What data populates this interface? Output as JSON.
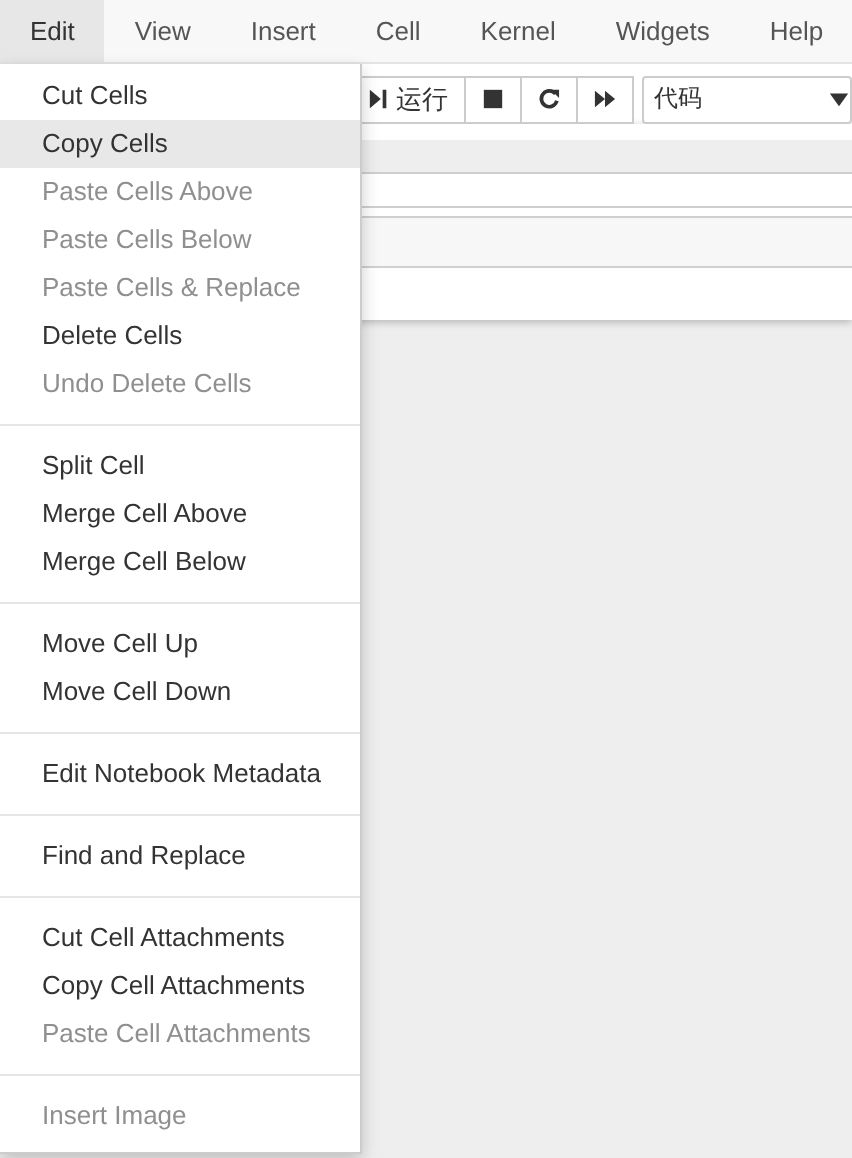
{
  "menubar": [
    {
      "label": "Edit",
      "selected": true
    },
    {
      "label": "View",
      "selected": false
    },
    {
      "label": "Insert",
      "selected": false
    },
    {
      "label": "Cell",
      "selected": false
    },
    {
      "label": "Kernel",
      "selected": false
    },
    {
      "label": "Widgets",
      "selected": false
    },
    {
      "label": "Help",
      "selected": false
    }
  ],
  "toolbar": {
    "run_button": {
      "label": "运行"
    },
    "buttons": [
      {
        "kind": "stop"
      },
      {
        "kind": "restart"
      },
      {
        "kind": "fast-forward"
      }
    ],
    "cell_type_select": {
      "value": "代码"
    }
  },
  "dropdown": {
    "groups": [
      [
        {
          "label": "Cut Cells",
          "disabled": false,
          "selected": false
        },
        {
          "label": "Copy Cells",
          "disabled": false,
          "selected": true
        },
        {
          "label": "Paste Cells Above",
          "disabled": true,
          "selected": false
        },
        {
          "label": "Paste Cells Below",
          "disabled": true,
          "selected": false
        },
        {
          "label": "Paste Cells & Replace",
          "disabled": true,
          "selected": false
        },
        {
          "label": "Delete Cells",
          "disabled": false,
          "selected": false
        },
        {
          "label": "Undo Delete Cells",
          "disabled": true,
          "selected": false
        }
      ],
      [
        {
          "label": "Split Cell",
          "disabled": false,
          "selected": false
        },
        {
          "label": "Merge Cell Above",
          "disabled": false,
          "selected": false
        },
        {
          "label": "Merge Cell Below",
          "disabled": false,
          "selected": false
        }
      ],
      [
        {
          "label": "Move Cell Up",
          "disabled": false,
          "selected": false
        },
        {
          "label": "Move Cell Down",
          "disabled": false,
          "selected": false
        }
      ],
      [
        {
          "label": "Edit Notebook Metadata",
          "disabled": false,
          "selected": false
        }
      ],
      [
        {
          "label": "Find and Replace",
          "disabled": false,
          "selected": false
        }
      ],
      [
        {
          "label": "Cut Cell Attachments",
          "disabled": false,
          "selected": false
        },
        {
          "label": "Copy Cell Attachments",
          "disabled": false,
          "selected": false
        },
        {
          "label": "Paste Cell Attachments",
          "disabled": true,
          "selected": false
        }
      ],
      [
        {
          "label": "Insert Image",
          "disabled": true,
          "selected": false
        }
      ]
    ]
  }
}
